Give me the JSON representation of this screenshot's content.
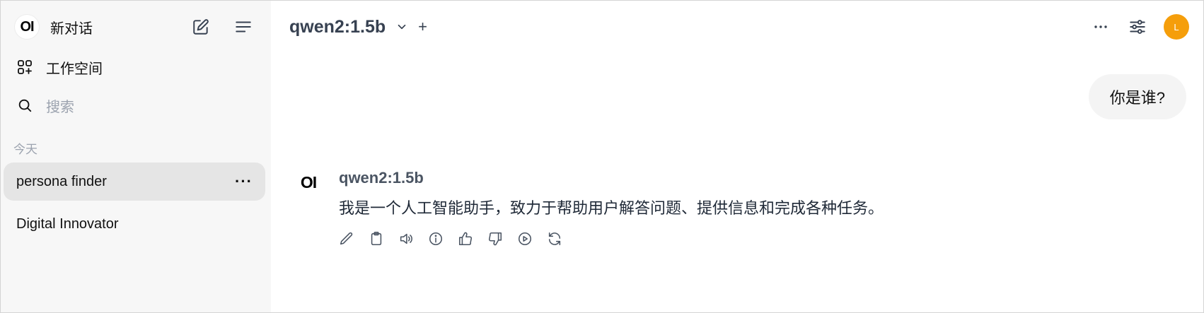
{
  "sidebar": {
    "logo_text": "OI",
    "new_chat_label": "新对话",
    "new_chat_icon": "compose-icon",
    "menu_icon": "menu-icon",
    "workspace_label": "工作空间",
    "workspace_icon": "workspace-grid-icon",
    "search_placeholder": "搜索",
    "search_icon": "search-icon",
    "section_today": "今天",
    "chats": [
      {
        "title": "persona finder",
        "active": true,
        "menu": "···"
      },
      {
        "title": "Digital Innovator",
        "active": false
      }
    ]
  },
  "header": {
    "model_name": "qwen2:1.5b",
    "add_model": "+",
    "more_icon": "more-horizontal-icon",
    "controls_icon": "sliders-icon",
    "avatar_letter": "L",
    "avatar_color": "#f59e0b"
  },
  "conversation": {
    "user_message": "你是谁?",
    "assistant": {
      "avatar_text": "OI",
      "model_name": "qwen2:1.5b",
      "message": "我是一个人工智能助手，致力于帮助用户解答问题、提供信息和完成各种任务。",
      "actions": [
        "edit-icon",
        "copy-icon",
        "read-aloud-icon",
        "info-icon",
        "thumbs-up-icon",
        "thumbs-down-icon",
        "play-icon",
        "regenerate-icon"
      ]
    }
  }
}
